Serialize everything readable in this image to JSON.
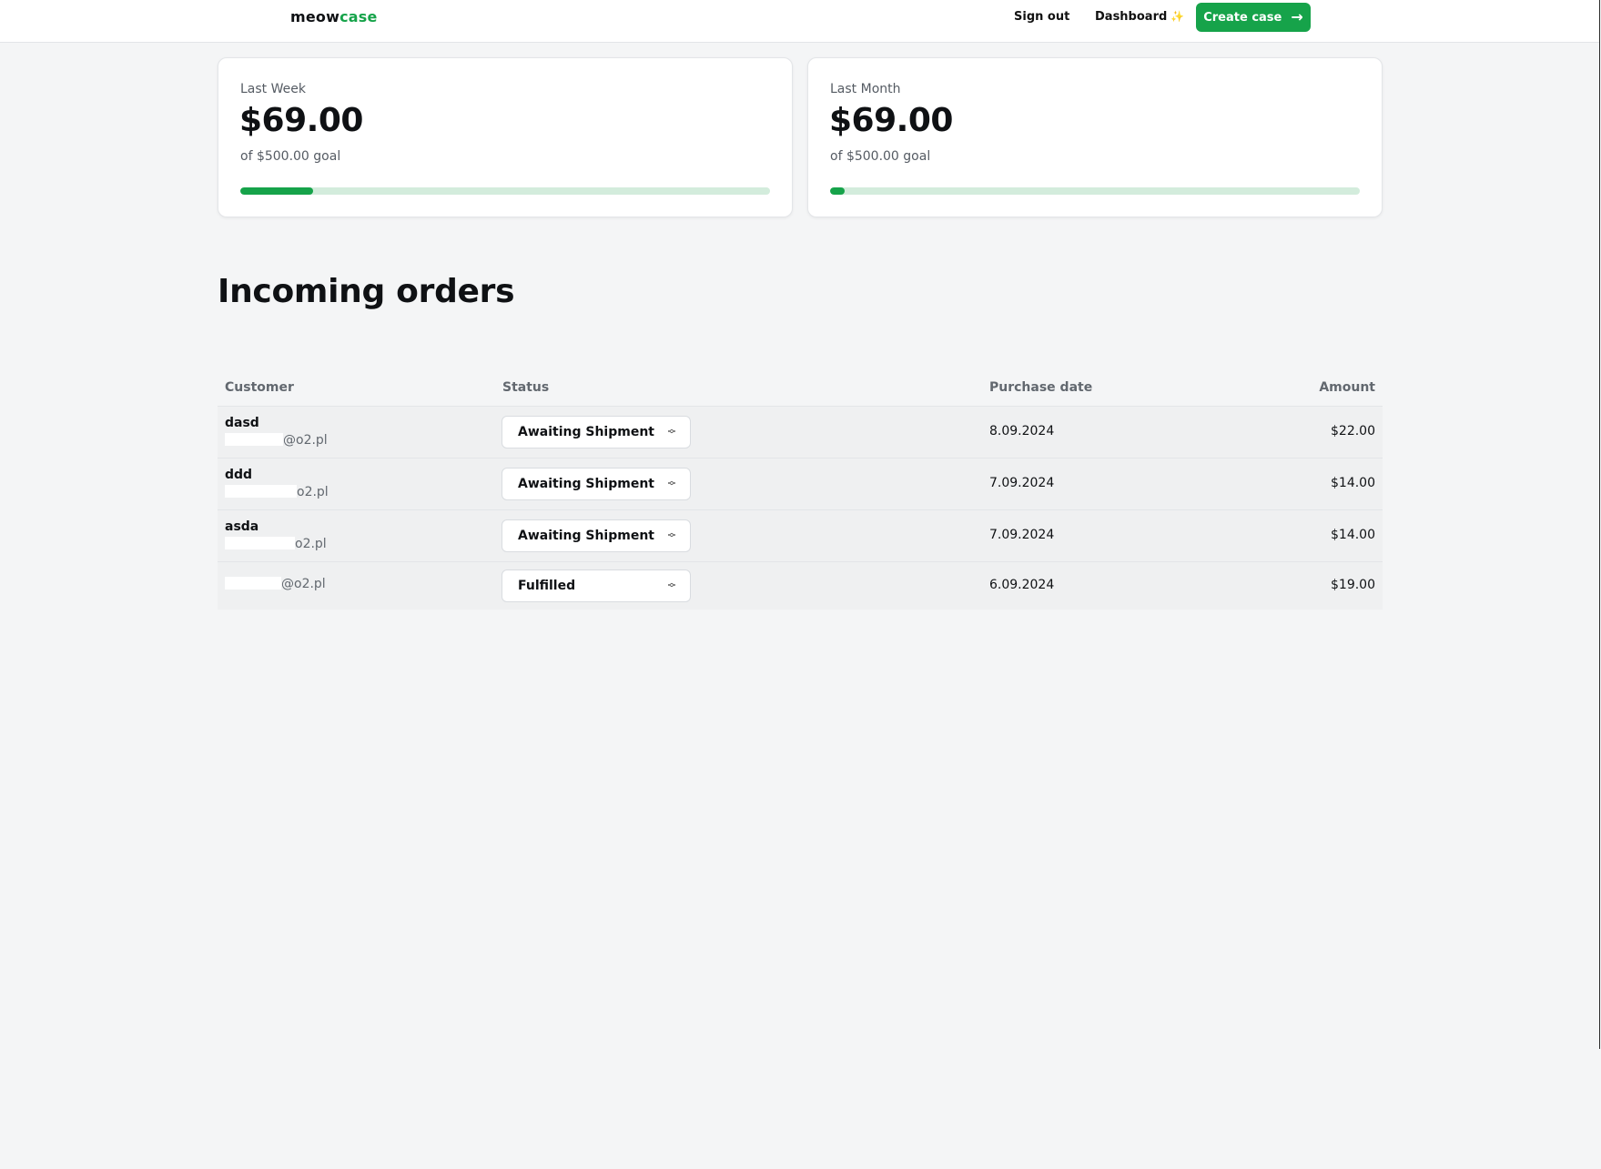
{
  "navbar": {
    "brand_primary": "meow",
    "brand_accent": "case",
    "sign_out": "Sign out",
    "dashboard": "Dashboard",
    "dashboard_icon": "sparkles-icon",
    "create_case": "Create case",
    "create_case_icon": "arrow-right-icon"
  },
  "colors": {
    "accent": "#16a34a",
    "track": "#d3ecdc",
    "sparkle": "#f59e0b"
  },
  "stats": [
    {
      "label": "Last Week",
      "value": "$69.00",
      "goal": "of $500.00 goal",
      "progress": 0.138
    },
    {
      "label": "Last Month",
      "value": "$69.00",
      "goal": "of $500.00 goal",
      "progress": 0.027
    }
  ],
  "heading": "Incoming orders",
  "table": {
    "headers": {
      "customer": "Customer",
      "status": "Status",
      "date": "Purchase date",
      "amount": "Amount"
    },
    "rows": [
      {
        "name": "dasd",
        "email": "@o2.pl",
        "status": "Awaiting Shipment",
        "date": "8.09.2024",
        "amount": "$22.00"
      },
      {
        "name": "ddd",
        "email": "o2.pl",
        "status": "Awaiting Shipment",
        "date": "7.09.2024",
        "amount": "$14.00"
      },
      {
        "name": "asda",
        "email": "o2.pl",
        "status": "Awaiting Shipment",
        "date": "7.09.2024",
        "amount": "$14.00"
      },
      {
        "name": "",
        "email": "@o2.pl",
        "status": "Fulfilled",
        "date": "6.09.2024",
        "amount": "$19.00"
      }
    ]
  }
}
